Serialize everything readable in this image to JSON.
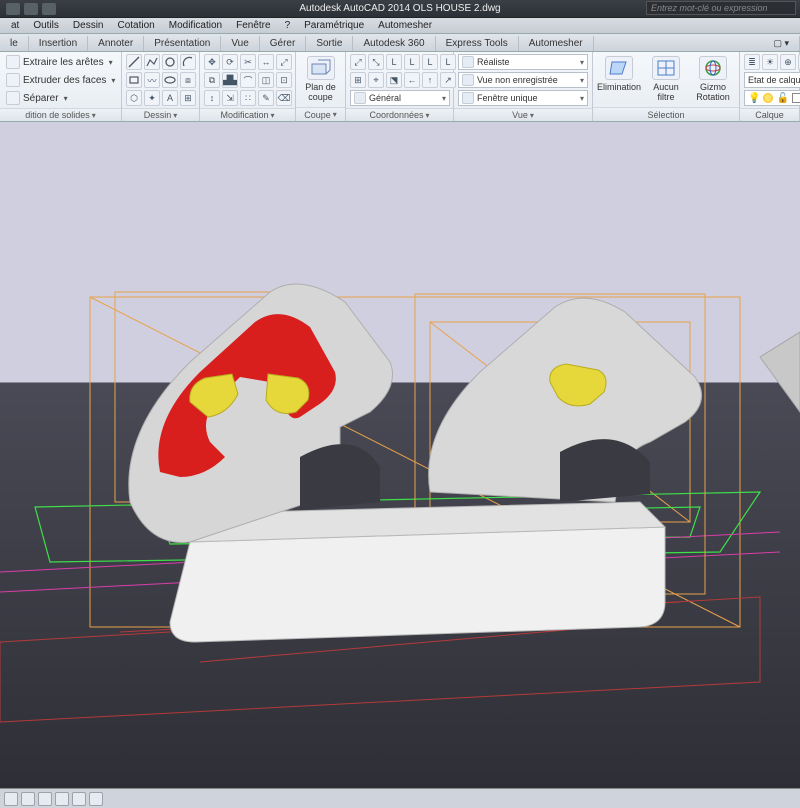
{
  "app": {
    "title": "Autodesk AutoCAD 2014   OLS HOUSE 2.dwg",
    "search_placeholder": "Entrez mot-clé ou expression"
  },
  "menus": [
    "at",
    "Outils",
    "Dessin",
    "Cotation",
    "Modification",
    "Fenêtre",
    "?",
    "Paramétrique",
    "Automesher"
  ],
  "tabs": [
    "le",
    "Insertion",
    "Annoter",
    "Présentation",
    "Vue",
    "Gérer",
    "Sortie",
    "Autodesk 360",
    "Express Tools",
    "Automesher"
  ],
  "panel_solids": {
    "extract": "Extraire les arêtes",
    "extrude": "Extruder des faces",
    "separate": "Séparer",
    "label": "dition de solides"
  },
  "panel_dessin": {
    "label": "Dessin"
  },
  "panel_modif": {
    "label": "Modification"
  },
  "panel_coupe": {
    "big": "Plan\nde coupe",
    "label": "Coupe"
  },
  "panel_coord": {
    "label": "Coordonnées",
    "sub_general": "Général"
  },
  "panel_vue": {
    "realistic": "Réaliste",
    "unsaved": "Vue non enregistrée",
    "single": "Fenêtre unique",
    "label": "Vue"
  },
  "panel_selection": {
    "elim": "Elimination",
    "filter": "Aucun filtre",
    "gizmo": "Gizmo Rotation",
    "label": "Sélection"
  },
  "panel_calque": {
    "state": "Etat de calque non e",
    "label": "Calque"
  }
}
